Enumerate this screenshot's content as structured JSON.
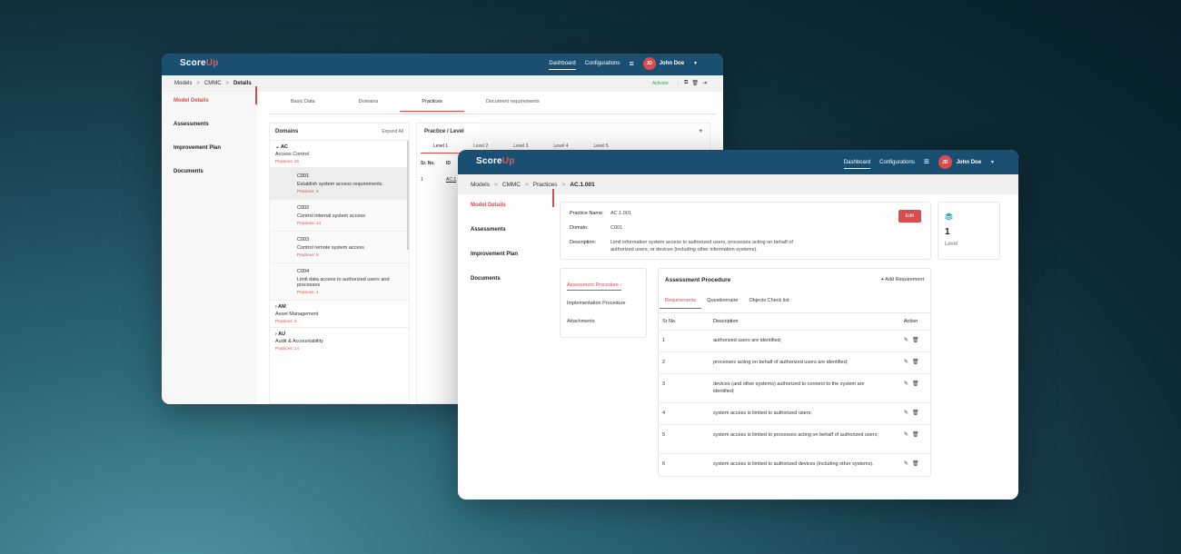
{
  "brand": {
    "name": "Score",
    "suffix": "Up",
    "accent": "#d94c4c",
    "header_bg": "#1b4f72"
  },
  "back": {
    "nav": {
      "dashboard": "Dashboard",
      "configurations": "Configurations",
      "user_initials": "JD",
      "user_name": "John Doe"
    },
    "breadcrumb": [
      "Models",
      "CMMC",
      "Details"
    ],
    "actions": {
      "activate": "Activate"
    },
    "sidebar": [
      "Model Details",
      "Assessments",
      "Improvement Plan",
      "Documents"
    ],
    "tabs": [
      "Basic Data",
      "Domains",
      "Practices",
      "Document requirements"
    ],
    "domains": {
      "title": "Domains",
      "expand_all": "Expand All",
      "groups": [
        {
          "code": "AC",
          "name": "Access Control",
          "practices": "Practices: 26"
        },
        {
          "code": "AM",
          "name": "Asset Management",
          "practices": "Practices: 3"
        },
        {
          "code": "AU",
          "name": "Audit & Accountability",
          "practices": "Practices: 14"
        }
      ],
      "sub": [
        {
          "code": "C001",
          "name": "Establish system access requirements",
          "practices": "Practices: 3"
        },
        {
          "code": "C002",
          "name": "Control internal system access",
          "practices": "Practices: 14"
        },
        {
          "code": "C003",
          "name": "Control remote system access",
          "practices": "Practices: 5"
        },
        {
          "code": "C004",
          "name": "Limit data access to authorized users and processes",
          "practices": "Practices: 4"
        }
      ]
    },
    "practice": {
      "title": "Practice / Level",
      "add": "+",
      "levels": [
        "Level 1",
        "Level 2",
        "Level 3",
        "Level 4",
        "Level 5"
      ],
      "cols": [
        "Sr. No.",
        "ID"
      ],
      "row": [
        "1",
        "AC.1"
      ]
    }
  },
  "front": {
    "nav": {
      "dashboard": "Dashboard",
      "configurations": "Configurations",
      "user_initials": "JD",
      "user_name": "John Doe"
    },
    "breadcrumb": [
      "Models",
      "CMMC",
      "Practices",
      "AC.1.001"
    ],
    "sidebar": [
      "Model Details",
      "Assessments",
      "Improvement Plan",
      "Documents"
    ],
    "info": {
      "name_label": "Practice Name:",
      "name": "AC.1.001",
      "domain_label": "Domain:",
      "domain": "C001",
      "desc_label": "Description:",
      "desc": "Limit information system access to authorized users, processes acting on behalf of authorized users, or devices (including other information systems).",
      "edit": "Edit"
    },
    "level": {
      "value": "1",
      "label": "Level"
    },
    "procedures": [
      "Assessment Procedure",
      "Implementation Procedure",
      "Attachments"
    ],
    "assessment": {
      "title": "Assessment Procedure",
      "add": "Add Requirement",
      "tabs": [
        "Requirements",
        "Questionnaire",
        "Objects Check list"
      ],
      "headers": [
        "Sr No.",
        "Description",
        "Action"
      ],
      "rows": [
        {
          "no": "1",
          "desc": "authorized users are identified;"
        },
        {
          "no": "2",
          "desc": "processes acting on behalf of authorized users are identified;"
        },
        {
          "no": "3",
          "desc": "devices (and other systems) authorized to connect to the system are identified;"
        },
        {
          "no": "4",
          "desc": "system access is limited to authorized users;"
        },
        {
          "no": "5",
          "desc": "system access is limited to processes acting on behalf of authorized users;"
        },
        {
          "no": "6",
          "desc": "system access is limited to authorized devices (including other systems)."
        }
      ]
    }
  }
}
